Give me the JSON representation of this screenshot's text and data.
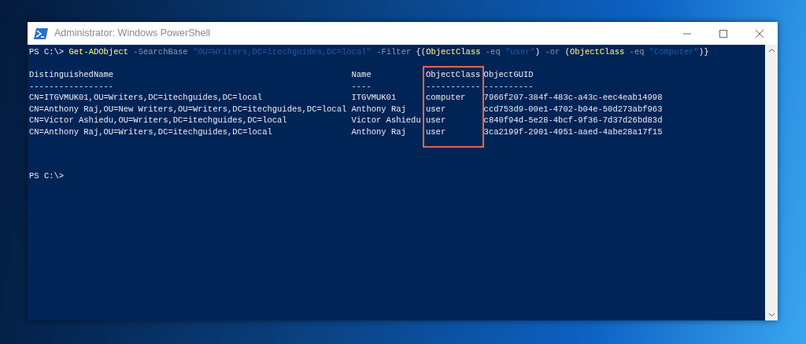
{
  "window": {
    "title": "Administrator: Windows PowerShell"
  },
  "command": {
    "prompt": "PS C:\\>",
    "words": [
      [
        {
          "text": "Get-ADObject",
          "kind": "cmdlet"
        }
      ],
      [
        {
          "text": "-SearchBase",
          "kind": "param"
        }
      ],
      [
        {
          "text": "\"OU=Writers,DC=itechguides,DC=local\"",
          "kind": "string"
        }
      ],
      [
        {
          "text": "-Filter",
          "kind": "param"
        }
      ],
      [
        {
          "text": "{(",
          "kind": "plain"
        },
        {
          "text": "ObjectClass",
          "kind": "cmdlet"
        }
      ],
      [
        {
          "text": "-eq",
          "kind": "param"
        }
      ],
      [
        {
          "text": "\"user\"",
          "kind": "string"
        },
        {
          "text": ")",
          "kind": "plain"
        }
      ],
      [
        {
          "text": "-or",
          "kind": "param"
        }
      ],
      [
        {
          "text": "(",
          "kind": "plain"
        },
        {
          "text": "ObjectClass",
          "kind": "cmdlet"
        }
      ],
      [
        {
          "text": "-eq",
          "kind": "param"
        }
      ],
      [
        {
          "text": "\"Computer\"",
          "kind": "string"
        },
        {
          "text": ")}",
          "kind": "plain"
        }
      ]
    ]
  },
  "table": {
    "columns": [
      {
        "header": "DistinguishedName",
        "rule": "-----------------",
        "highlighted": false,
        "cells": [
          "CN=ITGVMUK01,OU=Writers,DC=itechguides,DC=local",
          "CN=Anthony Raj,OU=New Writers,OU=Writers,DC=itechguides,DC=local",
          "CN=Victor Ashiedu,OU=Writers,DC=itechguides,DC=local",
          "CN=Anthony Raj,OU=Writers,DC=itechguides,DC=local"
        ]
      },
      {
        "header": "Name",
        "rule": "----",
        "highlighted": false,
        "cells": [
          "ITGVMUK01",
          "Anthony Raj",
          "Victor Ashiedu",
          "Anthony Raj"
        ]
      },
      {
        "header": "ObjectClass",
        "rule": "-----------",
        "highlighted": true,
        "cells": [
          "computer",
          "user",
          "user",
          "user"
        ]
      },
      {
        "header": "ObjectGUID",
        "rule": "----------",
        "highlighted": false,
        "cells": [
          "7966f207-384f-483c-a43c-eec4eab14998",
          "ccd753d9-00e1-4702-b04e-50d273abf963",
          "c840f94d-5e28-4bcf-9f36-7d37d26bd83d",
          "3ca2199f-2901-4951-aaed-4abe28a17f15"
        ]
      }
    ]
  },
  "prompt": "PS C:\\>"
}
